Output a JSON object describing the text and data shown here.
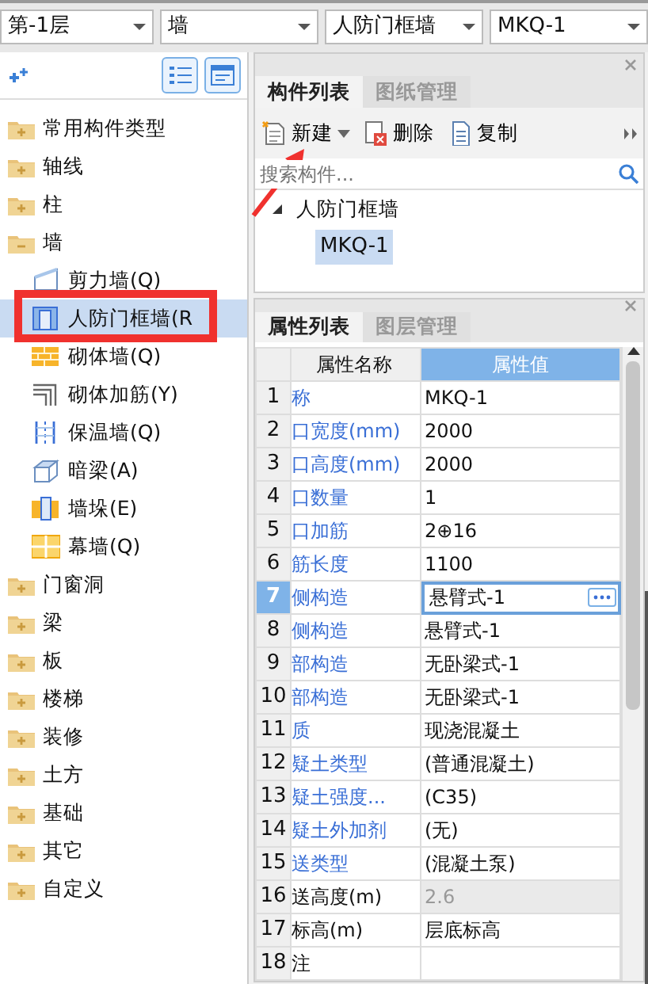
{
  "selectors": [
    {
      "value": "第-1层"
    },
    {
      "value": "墙"
    },
    {
      "value": "人防门框墙"
    },
    {
      "value": "MKQ-1"
    }
  ],
  "sidebar": {
    "items": [
      {
        "label": "常用构件类型",
        "expanded": false
      },
      {
        "label": "轴线",
        "expanded": false
      },
      {
        "label": "柱",
        "expanded": false
      },
      {
        "label": "墙",
        "expanded": true,
        "children": [
          {
            "label": "剪力墙(Q)",
            "kind": "shear",
            "selected": false
          },
          {
            "label": "人防门框墙(R",
            "kind": "frame",
            "selected": true
          },
          {
            "label": "砌体墙(Q)",
            "kind": "brick",
            "selected": false
          },
          {
            "label": "砌体加筋(Y)",
            "kind": "rebar",
            "selected": false
          },
          {
            "label": "保温墙(Q)",
            "kind": "insulation",
            "selected": false
          },
          {
            "label": "暗梁(A)",
            "kind": "beam",
            "selected": false
          },
          {
            "label": "墙垛(E)",
            "kind": "pier",
            "selected": false
          },
          {
            "label": "幕墙(Q)",
            "kind": "curtain",
            "selected": false
          }
        ]
      },
      {
        "label": "门窗洞",
        "expanded": false
      },
      {
        "label": "梁",
        "expanded": false
      },
      {
        "label": "板",
        "expanded": false
      },
      {
        "label": "楼梯",
        "expanded": false
      },
      {
        "label": "装修",
        "expanded": false
      },
      {
        "label": "土方",
        "expanded": false
      },
      {
        "label": "基础",
        "expanded": false
      },
      {
        "label": "其它",
        "expanded": false
      },
      {
        "label": "自定义",
        "expanded": false
      }
    ]
  },
  "component_panel": {
    "tabs": [
      {
        "label": "构件列表",
        "selected": true
      },
      {
        "label": "图纸管理",
        "selected": false
      }
    ],
    "toolbar": [
      {
        "label": "新建",
        "kind": "new"
      },
      {
        "label": "删除",
        "kind": "delete"
      },
      {
        "label": "复制",
        "kind": "copy"
      }
    ],
    "search": {
      "placeholder": "搜索构件..."
    },
    "tree": [
      {
        "label": "人防门框墙",
        "expanded": true,
        "children": [
          {
            "label": "MKQ-1",
            "selected": true
          }
        ]
      }
    ]
  },
  "property_panel": {
    "tabs": [
      {
        "label": "属性列表",
        "selected": true
      },
      {
        "label": "图层管理",
        "selected": false
      }
    ],
    "columns": [
      "属性名称",
      "属性值"
    ],
    "rows": [
      {
        "index": "1",
        "name": "称",
        "value": "MKQ-1",
        "public": true,
        "selected": false,
        "disabled": false
      },
      {
        "index": "2",
        "name": "口宽度(mm)",
        "value": "2000",
        "public": true,
        "selected": false,
        "disabled": false
      },
      {
        "index": "3",
        "name": "口高度(mm)",
        "value": "2000",
        "public": true,
        "selected": false,
        "disabled": false
      },
      {
        "index": "4",
        "name": "口数量",
        "value": "1",
        "public": true,
        "selected": false,
        "disabled": false
      },
      {
        "index": "5",
        "name": "口加筋",
        "value": "2⊕16",
        "public": true,
        "selected": false,
        "disabled": false
      },
      {
        "index": "6",
        "name": "筋长度",
        "value": "1100",
        "public": true,
        "selected": false,
        "disabled": false
      },
      {
        "index": "7",
        "name": "侧构造",
        "value": "悬臂式-1",
        "public": true,
        "selected": true,
        "disabled": false
      },
      {
        "index": "8",
        "name": "侧构造",
        "value": "悬臂式-1",
        "public": true,
        "selected": false,
        "disabled": false
      },
      {
        "index": "9",
        "name": "部构造",
        "value": "无卧梁式-1",
        "public": true,
        "selected": false,
        "disabled": false
      },
      {
        "index": "10",
        "name": "部构造",
        "value": "无卧梁式-1",
        "public": true,
        "selected": false,
        "disabled": false
      },
      {
        "index": "11",
        "name": "质",
        "value": "现浇混凝土",
        "public": true,
        "selected": false,
        "disabled": false
      },
      {
        "index": "12",
        "name": "疑土类型",
        "value": "(普通混凝土)",
        "public": true,
        "selected": false,
        "disabled": false
      },
      {
        "index": "13",
        "name": "疑土强度...",
        "value": "(C35)",
        "public": true,
        "selected": false,
        "disabled": false
      },
      {
        "index": "14",
        "name": "疑土外加剂",
        "value": "(无)",
        "public": true,
        "selected": false,
        "disabled": false
      },
      {
        "index": "15",
        "name": "送类型",
        "value": "(混凝土泵)",
        "public": true,
        "selected": false,
        "disabled": false
      },
      {
        "index": "16",
        "name": "送高度(m)",
        "value": "2.6",
        "public": false,
        "selected": false,
        "disabled": true
      },
      {
        "index": "17",
        "name": "标高(m)",
        "value": "层底标高",
        "public": false,
        "selected": false,
        "disabled": false
      },
      {
        "index": "18",
        "name": "注",
        "value": "",
        "public": false,
        "selected": false,
        "disabled": false
      }
    ]
  },
  "annotations": {
    "highlight_box": true,
    "arrow": true
  }
}
